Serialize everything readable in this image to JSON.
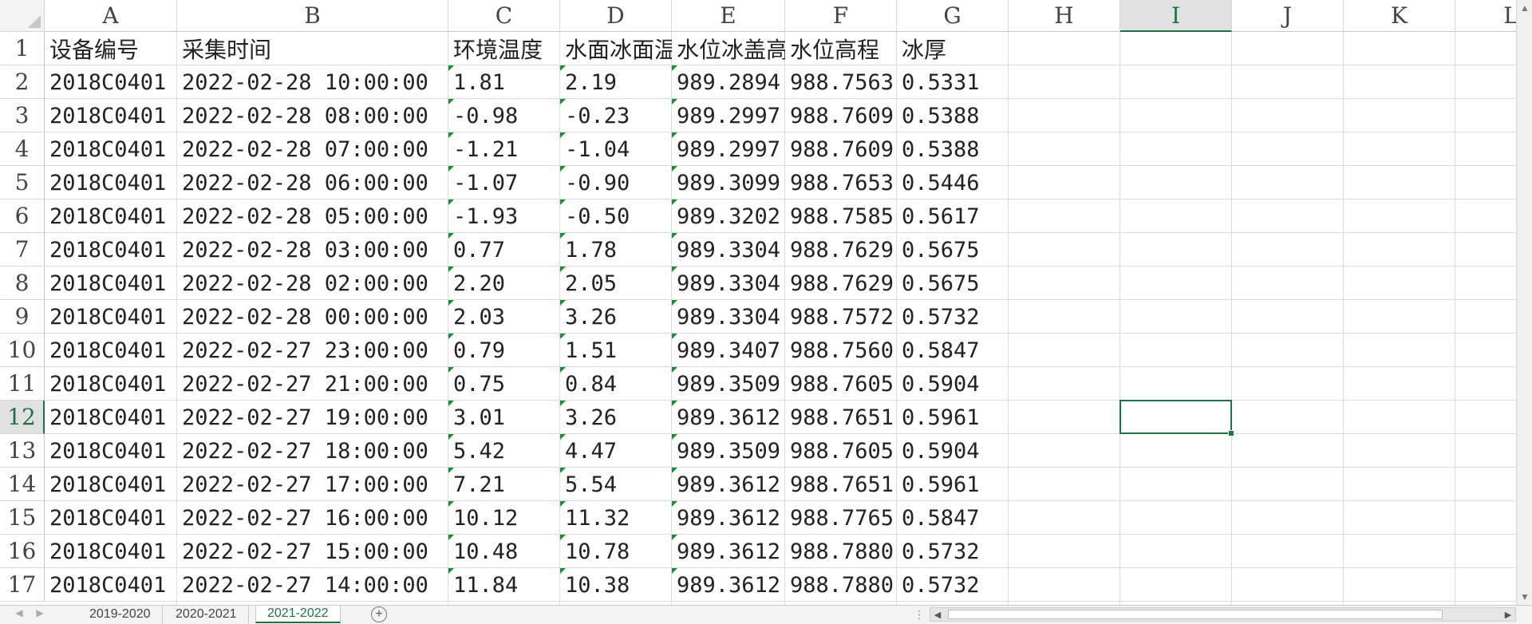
{
  "columns": [
    "A",
    "B",
    "C",
    "D",
    "E",
    "F",
    "G",
    "H",
    "I",
    "J",
    "K",
    "L"
  ],
  "selected_column": "I",
  "selected_row": "12",
  "header_row": {
    "row_number": "1",
    "cells": [
      "设备编号",
      "采集时间",
      "环境温度",
      "水面冰面温",
      "水位冰盖高",
      "水位高程",
      "冰厚"
    ]
  },
  "rows": [
    {
      "n": "2",
      "cells": [
        "2018C0401",
        "2022-02-28 10:00:00",
        "1.81",
        "2.19",
        "989.2894",
        "988.7563",
        "0.5331"
      ]
    },
    {
      "n": "3",
      "cells": [
        "2018C0401",
        "2022-02-28 08:00:00",
        "-0.98",
        "-0.23",
        "989.2997",
        "988.7609",
        "0.5388"
      ]
    },
    {
      "n": "4",
      "cells": [
        "2018C0401",
        "2022-02-28 07:00:00",
        "-1.21",
        "-1.04",
        "989.2997",
        "988.7609",
        "0.5388"
      ]
    },
    {
      "n": "5",
      "cells": [
        "2018C0401",
        "2022-02-28 06:00:00",
        "-1.07",
        "-0.90",
        "989.3099",
        "988.7653",
        "0.5446"
      ]
    },
    {
      "n": "6",
      "cells": [
        "2018C0401",
        "2022-02-28 05:00:00",
        "-1.93",
        "-0.50",
        "989.3202",
        "988.7585",
        "0.5617"
      ]
    },
    {
      "n": "7",
      "cells": [
        "2018C0401",
        "2022-02-28 03:00:00",
        "0.77",
        "1.78",
        "989.3304",
        "988.7629",
        "0.5675"
      ]
    },
    {
      "n": "8",
      "cells": [
        "2018C0401",
        "2022-02-28 02:00:00",
        "2.20",
        "2.05",
        "989.3304",
        "988.7629",
        "0.5675"
      ]
    },
    {
      "n": "9",
      "cells": [
        "2018C0401",
        "2022-02-28 00:00:00",
        "2.03",
        "3.26",
        "989.3304",
        "988.7572",
        "0.5732"
      ]
    },
    {
      "n": "10",
      "cells": [
        "2018C0401",
        "2022-02-27 23:00:00",
        "0.79",
        "1.51",
        "989.3407",
        "988.7560",
        "0.5847"
      ]
    },
    {
      "n": "11",
      "cells": [
        "2018C0401",
        "2022-02-27 21:00:00",
        "0.75",
        "0.84",
        "989.3509",
        "988.7605",
        "0.5904"
      ]
    },
    {
      "n": "12",
      "cells": [
        "2018C0401",
        "2022-02-27 19:00:00",
        "3.01",
        "3.26",
        "989.3612",
        "988.7651",
        "0.5961"
      ]
    },
    {
      "n": "13",
      "cells": [
        "2018C0401",
        "2022-02-27 18:00:00",
        "5.42",
        "4.47",
        "989.3509",
        "988.7605",
        "0.5904"
      ]
    },
    {
      "n": "14",
      "cells": [
        "2018C0401",
        "2022-02-27 17:00:00",
        "7.21",
        "5.54",
        "989.3612",
        "988.7651",
        "0.5961"
      ]
    },
    {
      "n": "15",
      "cells": [
        "2018C0401",
        "2022-02-27 16:00:00",
        "10.12",
        "11.32",
        "989.3612",
        "988.7765",
        "0.5847"
      ]
    },
    {
      "n": "16",
      "cells": [
        "2018C0401",
        "2022-02-27 15:00:00",
        "10.48",
        "10.78",
        "989.3612",
        "988.7880",
        "0.5732"
      ]
    },
    {
      "n": "17",
      "cells": [
        "2018C0401",
        "2022-02-27 14:00:00",
        "11.84",
        "10.38",
        "989.3612",
        "988.7880",
        "0.5732"
      ]
    }
  ],
  "sheet_tabs": [
    {
      "label": "2019-2020",
      "active": false
    },
    {
      "label": "2020-2021",
      "active": false
    },
    {
      "label": "2021-2022",
      "active": true
    }
  ],
  "icons": {
    "add_sheet": "plus-circle-icon",
    "scroll_left": "arrow-left-icon",
    "scroll_right": "arrow-right-icon",
    "scroll_up": "arrow-up-icon",
    "scroll_down": "arrow-down-icon"
  },
  "colors": {
    "accent": "#217346",
    "comment_marker": "#1f8a3a",
    "gridline": "#dcdcdc"
  }
}
